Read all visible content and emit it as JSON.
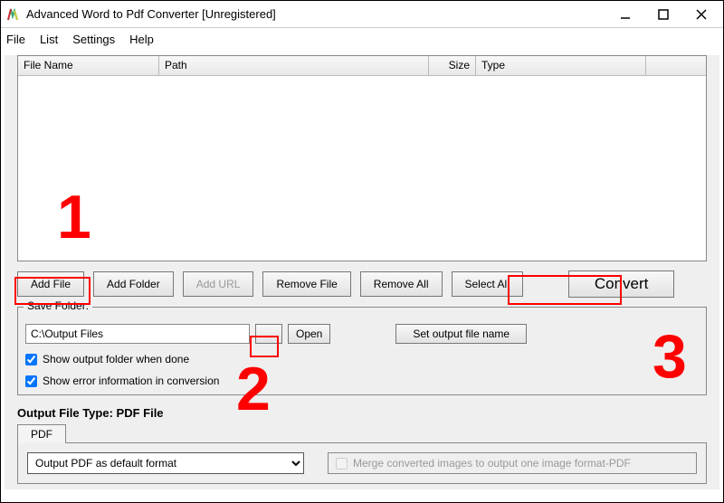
{
  "window": {
    "title": "Advanced Word to Pdf Converter [Unregistered]"
  },
  "menubar": [
    "File",
    "List",
    "Settings",
    "Help"
  ],
  "table": {
    "columns": [
      "File Name",
      "Path",
      "Size",
      "Type",
      ""
    ]
  },
  "buttons": {
    "add_file": "Add File",
    "add_folder": "Add Folder",
    "add_url": "Add URL",
    "remove_file": "Remove File",
    "remove_all": "Remove All",
    "select_all": "Select All",
    "convert": "Convert"
  },
  "save_folder": {
    "legend": "Save Folder:",
    "path": "C:\\Output Files",
    "browse": "...",
    "open": "Open",
    "set_output": "Set output file name",
    "checkbox1": "Show output folder when done",
    "checkbox2": "Show error information in conversion"
  },
  "output": {
    "label_prefix": "Output File Type:  ",
    "label_value": "PDF File",
    "tab": "PDF",
    "combo": "Output PDF as default format",
    "merge": "Merge converted images to output one image format-PDF"
  },
  "annotations": {
    "n1": "1",
    "n2": "2",
    "n3": "3"
  }
}
